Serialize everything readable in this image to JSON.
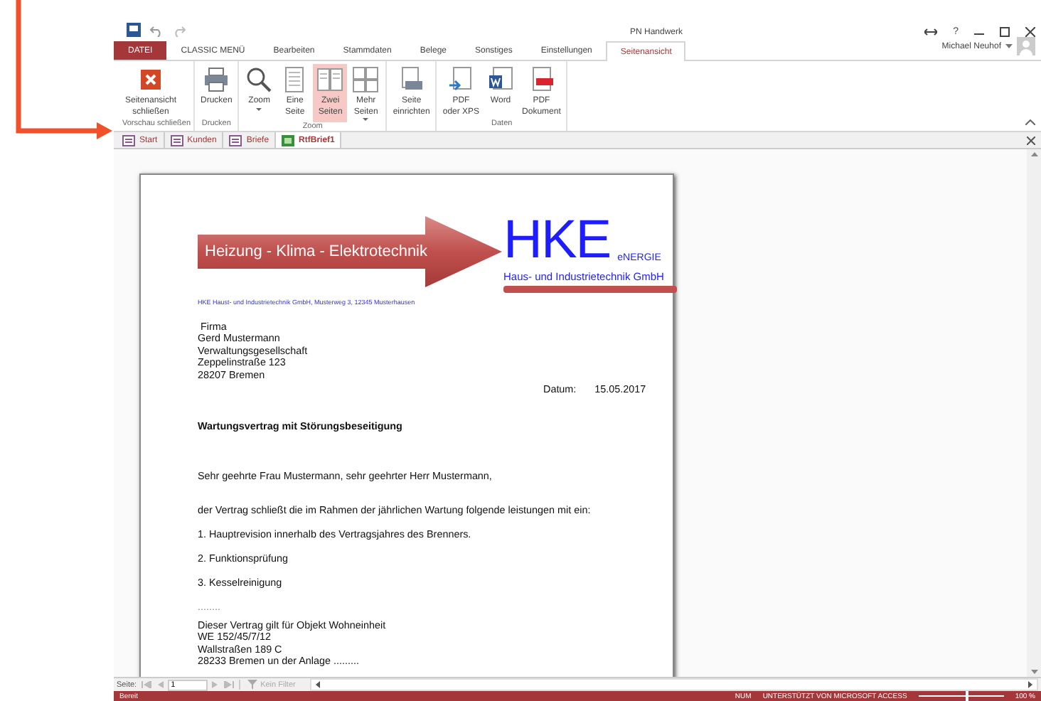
{
  "app": {
    "title": "PN Handwerk",
    "help": "?",
    "user": "Michael Neuhof"
  },
  "ribbon_tabs": [
    {
      "label": "DATEI",
      "kind": "file",
      "selected": false
    },
    {
      "label": "CLASSIC MENÜ",
      "kind": "tab",
      "selected": false
    },
    {
      "label": "Bearbeiten",
      "kind": "tab",
      "selected": false
    },
    {
      "label": "Stammdaten",
      "kind": "tab",
      "selected": false
    },
    {
      "label": "Belege",
      "kind": "tab",
      "selected": false
    },
    {
      "label": "Sonstiges",
      "kind": "tab",
      "selected": false
    },
    {
      "label": "Einstellungen",
      "kind": "tab",
      "selected": false
    },
    {
      "label": "Seitenansicht",
      "kind": "tab",
      "selected": true
    }
  ],
  "ribbon_groups": [
    {
      "label": "Vorschau schließen",
      "buttons": [
        {
          "lines": [
            "Seitenansicht",
            "schließen"
          ],
          "kind": "close",
          "dropdown": false,
          "selected": false
        }
      ]
    },
    {
      "label": "Drucken",
      "buttons": [
        {
          "lines": [
            "Drucken"
          ],
          "kind": "printer",
          "dropdown": false,
          "selected": false
        }
      ]
    },
    {
      "label": "Zoom",
      "buttons": [
        {
          "lines": [
            "Zoom"
          ],
          "kind": "magnifier",
          "dropdown": true,
          "selected": false
        },
        {
          "lines": [
            "Eine",
            "Seite"
          ],
          "kind": "one-page",
          "dropdown": false,
          "selected": false
        },
        {
          "lines": [
            "Zwei",
            "Seiten"
          ],
          "kind": "two-pages",
          "dropdown": false,
          "selected": true
        },
        {
          "lines": [
            "Mehr",
            "Seiten"
          ],
          "kind": "four-pages",
          "dropdown": true,
          "selected": false
        }
      ]
    },
    {
      "buttons": [
        {
          "lines": [
            "Seite",
            "einrichten"
          ],
          "kind": "page-setup",
          "dropdown": false,
          "selected": false
        }
      ]
    },
    {
      "label": "Daten",
      "buttons": [
        {
          "lines": [
            "PDF",
            "oder XPS"
          ],
          "kind": "export",
          "dropdown": false,
          "selected": false
        },
        {
          "lines": [
            "Word"
          ],
          "kind": "word",
          "dropdown": false,
          "selected": false
        },
        {
          "lines": [
            "PDF",
            "Dokument"
          ],
          "kind": "pdf",
          "dropdown": false,
          "selected": false
        }
      ]
    }
  ],
  "doc_tabs": [
    {
      "label": "Start",
      "kind": "form",
      "selected": false
    },
    {
      "label": "Kunden",
      "kind": "form",
      "selected": false
    },
    {
      "label": "Briefe",
      "kind": "form",
      "selected": false
    },
    {
      "label": "RtfBrief1",
      "kind": "report",
      "selected": true
    }
  ],
  "document": {
    "logo": {
      "slogan": "Heizung - Klima - Elektrotechnik",
      "wordmark": "HKE",
      "suffix": "eNERGIE",
      "company": "Haus- und Industrietechnik GmbH"
    },
    "sender_line": "HKE Haust- und Industrietechnik GmbH, Musterweg 3, 12345 Musterhausen",
    "address": [
      "Firma",
      "Gerd Mustermann",
      "Verwaltungsgesellschaft",
      "Zeppelinstraße 123",
      "28207 Bremen"
    ],
    "date_label": "Datum:",
    "date": "15.05.2017",
    "subject": "Wartungsvertrag mit Störungsbeseitigung",
    "salutation": "Sehr geehrte Frau Mustermann, sehr geehrter Herr Mustermann,",
    "intro": "der Vertrag schließt die im Rahmen der jährlichen Wartung folgende leistungen mit ein:",
    "items": [
      "1. Hauptrevision innerhalb des Vertragsjahres des Brenners.",
      "2. Funktionsprüfung",
      "3. Kesselreinigung"
    ],
    "ellipsis": "........",
    "object": [
      "Dieser Vertrag gilt für Objekt Wohneinheit",
      "WE 152/45/7/12",
      "Wallstraßen 189 C",
      "28233 Bremen un der Anlage  ........."
    ]
  },
  "nav": {
    "label": "Seite:",
    "page": "1",
    "filter": "Kein Filter"
  },
  "status": {
    "text": "Bereit",
    "indicators": [
      "NUM",
      "UNTERSTÜTZT VON MICROSOFT ACCESS"
    ],
    "zoom_slider": {
      "level": 0.55
    },
    "zoom": "100 %"
  }
}
